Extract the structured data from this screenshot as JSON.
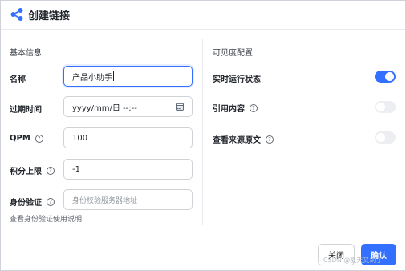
{
  "header": {
    "title": "创建链接",
    "icon": "share-icon",
    "accent": "#3370ff"
  },
  "left": {
    "section_title": "基本信息",
    "name": {
      "label": "名称",
      "value": "产品小助手"
    },
    "expire": {
      "label": "过期时间",
      "placeholder": "yyyy/mm/日 --:--",
      "icon": "calendar-icon"
    },
    "qpm": {
      "label": "QPM",
      "value": "100"
    },
    "points": {
      "label": "积分上限",
      "value": "-1"
    },
    "auth": {
      "label": "身份验证",
      "placeholder": "身份校验服务器地址"
    },
    "auth_link": "查看身份验证使用说明"
  },
  "right": {
    "section_title": "可见度配置",
    "realtime": {
      "label": "实时运行状态",
      "enabled": true
    },
    "quote": {
      "label": "引用内容",
      "enabled": false
    },
    "source": {
      "label": "查看来源原文",
      "enabled": false
    }
  },
  "footer": {
    "cancel_label": "关闭",
    "confirm_label": "确认"
  },
  "watermark": "CSDN @夏天又到了"
}
